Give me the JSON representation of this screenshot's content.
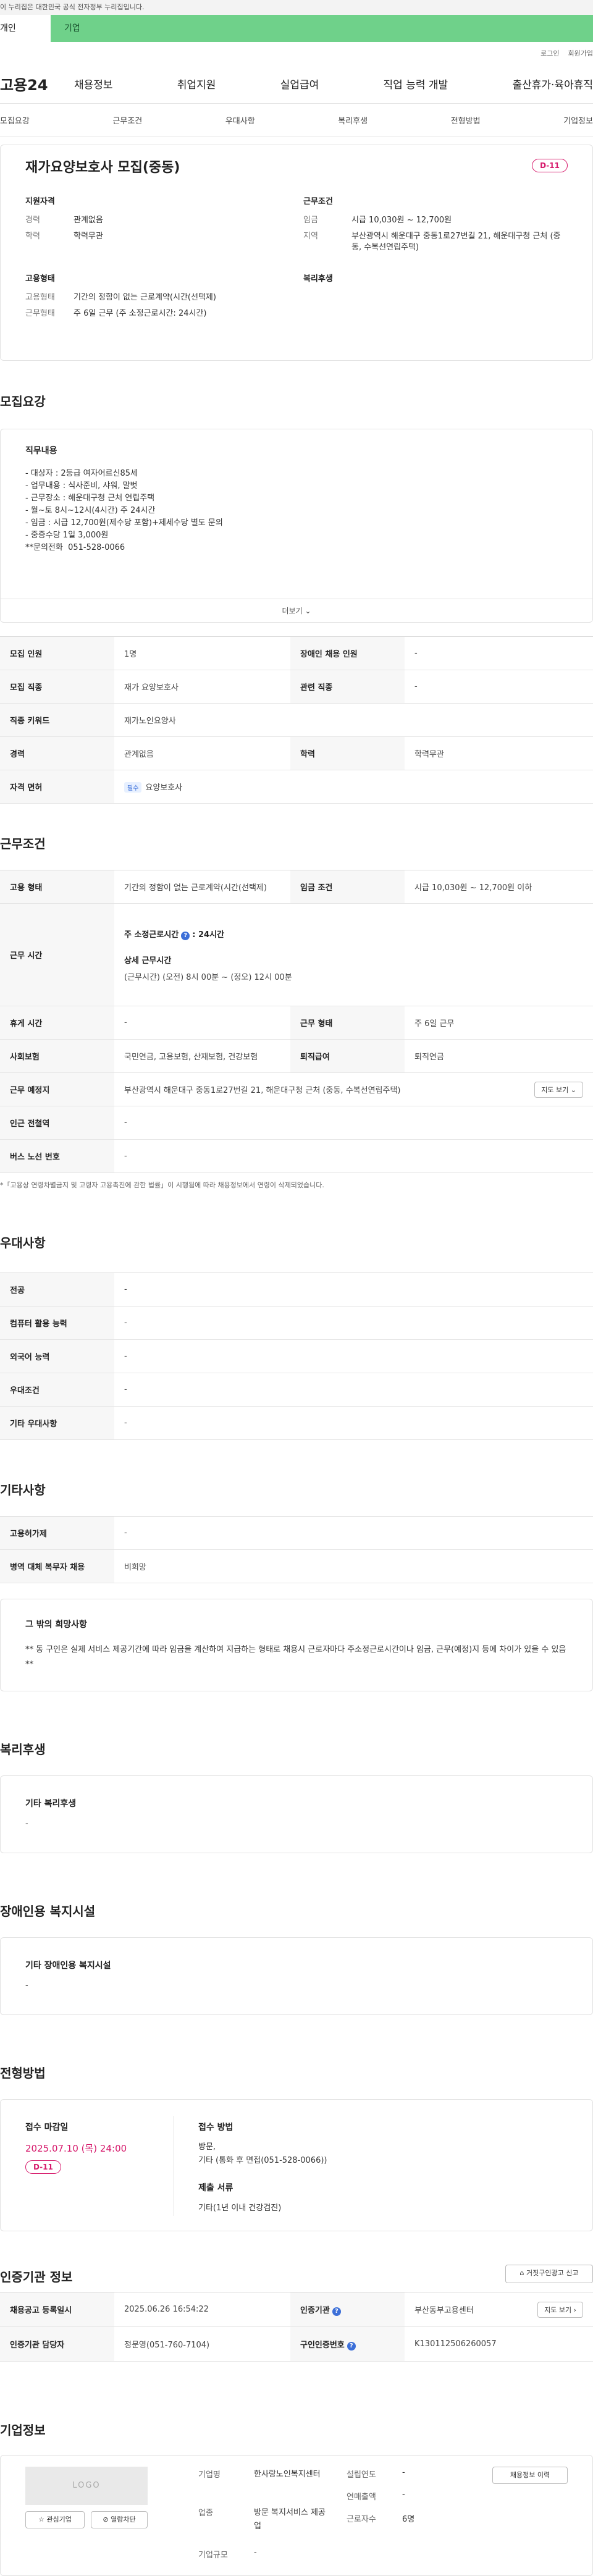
{
  "gov_banner": "이 누리집은 대한민국 공식 전자정부 누리집입니다.",
  "user_tabs": [
    "개인",
    "기업"
  ],
  "util": [
    "로그인",
    "회원가입"
  ],
  "gnb": {
    "logo": "고용24",
    "items": [
      "채용정보",
      "취업지원",
      "실업급여",
      "직업 능력 개발",
      "출산휴가·육아휴직"
    ]
  },
  "subnav": [
    "모집요강",
    "근무조건",
    "우대사항",
    "복리후생",
    "전형방법",
    "기업정보"
  ],
  "job": {
    "title": "재가요양보호사 모집(중동)",
    "dday": "D-11",
    "qualification": {
      "heading": "지원자격",
      "rows": [
        {
          "k": "경력",
          "v": "관계없음"
        },
        {
          "k": "학력",
          "v": "학력무관"
        }
      ]
    },
    "conditions": {
      "heading": "근무조건",
      "rows": [
        {
          "k": "임금",
          "v": "시급 10,030원 ~ 12,700원"
        },
        {
          "k": "지역",
          "v": "부산광역시 해운대구 중동1로27번길 21, 해운대구청 근처 (중동, 수복선연립주택)"
        }
      ]
    },
    "employment": {
      "heading": "고용형태",
      "rows": [
        {
          "k": "고용형태",
          "v": "기간의 정함이 없는 근로계약(시간(선택제)"
        },
        {
          "k": "근무형태",
          "v": "주 6일 근무 (주 소정근로시간: 24시간)"
        }
      ]
    },
    "welfare_heading": "복리후생"
  },
  "recruit": {
    "section_title": "모집요강",
    "desc_heading": "직무내용",
    "desc_lines": [
      "- 대상자 : 2등급 여자어르신85세",
      "- 업무내용 : 식사준비, 샤워, 말벗",
      "- 근무장소 : 해운대구청 근처 연립주택",
      "- 월~토 8시~12시(4시간) 주 24시간",
      "- 임금 : 시급 12,700원(제수당 포함)+제세수당 별도 문의",
      "- 중증수당 1일 3,000원",
      "",
      "**문의전화  051-528-0066"
    ],
    "more": "더보기",
    "table": [
      {
        "k": "모집 인원",
        "v": "1명",
        "k2": "장애인 채용 인원",
        "v2": "-"
      },
      {
        "k": "모집 직종",
        "v": "재가 요양보호사",
        "k2": "관련 직종",
        "v2": "-"
      },
      {
        "k": "직종 키워드",
        "v": "재가노인요양사"
      },
      {
        "k": "경력",
        "v": "관계없음",
        "k2": "학력",
        "v2": "학력무관"
      },
      {
        "k": "자격 면허",
        "badge": "필수",
        "v": "요양보호사"
      }
    ]
  },
  "work": {
    "section_title": "근무조건",
    "emp_type_k": "고용 형태",
    "emp_type_v": "기간의 정함이 없는 근로계약(시간(선택제)",
    "wage_k": "임금 조건",
    "wage_v": "시급 10,030원 ~ 12,700원 이하",
    "hours_k": "근무 시간",
    "hours_main": "주 소정근로시간",
    "hours_value": ": 24시간",
    "hours_detail_h": "상세 근무시간",
    "hours_detail_v": "(근무시간) (오전) 8시 00분 ~ (정오) 12시 00분",
    "holiday_k": "휴게 시간",
    "holiday_v": "-",
    "worktype_k": "근무 형태",
    "worktype_v": "주 6일 근무",
    "insurance_k": "사회보험",
    "insurance_v": "국민연금, 고용보험, 산재보험, 건강보험",
    "retire_k": "퇴직급여",
    "retire_v": "퇴직연금",
    "place_k": "근무 예정지",
    "place_v": "부산광역시 해운대구 중동1로27번길 21, 해운대구청 근처 (중동, 수복선연립주택)",
    "map_btn": "지도 보기",
    "station_k": "인근 전철역",
    "station_v": "-",
    "bus_k": "버스 노선 번호",
    "bus_v": "-",
    "note": "*「고용상 연령차별금지 및 고령자 고용촉진에 관한 법률」이 시행됨에 따라 채용정보에서 연령이 삭제되었습니다."
  },
  "pref": {
    "section_title": "우대사항",
    "rows": [
      {
        "k": "전공",
        "v": "-"
      },
      {
        "k": "컴퓨터 활용 능력",
        "v": "-"
      },
      {
        "k": "외국어 능력",
        "v": "-"
      },
      {
        "k": "우대조건",
        "v": "-"
      },
      {
        "k": "기타 우대사항",
        "v": "-"
      }
    ]
  },
  "etc": {
    "section_title": "기타사항",
    "rows": [
      {
        "k": "고용허가제",
        "v": "-"
      },
      {
        "k": "병역 대체 복무자 채용",
        "v": "비희망"
      }
    ],
    "box_h": "그 밖의 희망사항",
    "box_v": "** 동 구인은 실제 서비스 제공기간에 따라 임금을 계산하여 지급하는 형태로 채용시 근로자마다 주소정근로시간이나 임금, 근무(예정)지 등에 차이가 있을 수 있음 **"
  },
  "welfare": {
    "section_title": "복리후생",
    "box_h": "기타 복리후생",
    "box_v": "-"
  },
  "disability": {
    "section_title": "장애인용 복지시설",
    "box_h": "기타 장애인용 복지시설",
    "box_v": "-"
  },
  "selection": {
    "section_title": "전형방법",
    "deadline_h": "접수 마감일",
    "deadline_v": "2025.07.10 (목) 24:00",
    "dday": "D-11",
    "method_h": "접수 방법",
    "method_v1": "방문,",
    "method_v2": "기타 (통화 후 면접(051-528-0066))",
    "docs_h": "제출 서류",
    "docs_v": "기타(1년 이내 건강검진)"
  },
  "cert": {
    "section_title": "인증기관 정보",
    "report_btn": "거짓구인광고 신고",
    "reg_k": "채용공고 등록일시",
    "reg_v": "2025.06.26 16:54:22",
    "org_k": "인증기관",
    "org_v": "부산동부고용센터",
    "map_btn": "지도 보기",
    "staff_k": "인증기관 담당자",
    "staff_v": "정문영(051-760-7104)",
    "num_k": "구인인증번호",
    "num_v": "K130112506260057"
  },
  "company": {
    "section_title": "기업정보",
    "logo": "LOGO",
    "fav_btn": "관심기업",
    "block_btn": "열람차단",
    "history_btn": "채용정보 이력",
    "name_k": "기업명",
    "name_v": "한사랑노인복지센터",
    "industry_k": "업종",
    "industry_v": "방문 복지서비스 제공업",
    "size_k": "기업규모",
    "size_v": "-",
    "founded_k": "설립연도",
    "founded_v": "-",
    "sales_k": "연매출액",
    "sales_v": "-",
    "emp_k": "근로자수",
    "emp_v": "6명"
  }
}
